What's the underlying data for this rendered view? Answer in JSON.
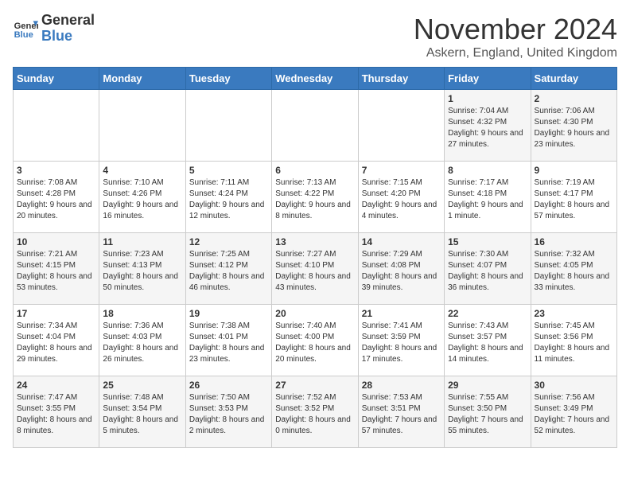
{
  "header": {
    "logo_line1": "General",
    "logo_line2": "Blue",
    "month_title": "November 2024",
    "location": "Askern, England, United Kingdom"
  },
  "weekdays": [
    "Sunday",
    "Monday",
    "Tuesday",
    "Wednesday",
    "Thursday",
    "Friday",
    "Saturday"
  ],
  "weeks": [
    [
      {
        "day": "",
        "info": ""
      },
      {
        "day": "",
        "info": ""
      },
      {
        "day": "",
        "info": ""
      },
      {
        "day": "",
        "info": ""
      },
      {
        "day": "",
        "info": ""
      },
      {
        "day": "1",
        "info": "Sunrise: 7:04 AM\nSunset: 4:32 PM\nDaylight: 9 hours and 27 minutes."
      },
      {
        "day": "2",
        "info": "Sunrise: 7:06 AM\nSunset: 4:30 PM\nDaylight: 9 hours and 23 minutes."
      }
    ],
    [
      {
        "day": "3",
        "info": "Sunrise: 7:08 AM\nSunset: 4:28 PM\nDaylight: 9 hours and 20 minutes."
      },
      {
        "day": "4",
        "info": "Sunrise: 7:10 AM\nSunset: 4:26 PM\nDaylight: 9 hours and 16 minutes."
      },
      {
        "day": "5",
        "info": "Sunrise: 7:11 AM\nSunset: 4:24 PM\nDaylight: 9 hours and 12 minutes."
      },
      {
        "day": "6",
        "info": "Sunrise: 7:13 AM\nSunset: 4:22 PM\nDaylight: 9 hours and 8 minutes."
      },
      {
        "day": "7",
        "info": "Sunrise: 7:15 AM\nSunset: 4:20 PM\nDaylight: 9 hours and 4 minutes."
      },
      {
        "day": "8",
        "info": "Sunrise: 7:17 AM\nSunset: 4:18 PM\nDaylight: 9 hours and 1 minute."
      },
      {
        "day": "9",
        "info": "Sunrise: 7:19 AM\nSunset: 4:17 PM\nDaylight: 8 hours and 57 minutes."
      }
    ],
    [
      {
        "day": "10",
        "info": "Sunrise: 7:21 AM\nSunset: 4:15 PM\nDaylight: 8 hours and 53 minutes."
      },
      {
        "day": "11",
        "info": "Sunrise: 7:23 AM\nSunset: 4:13 PM\nDaylight: 8 hours and 50 minutes."
      },
      {
        "day": "12",
        "info": "Sunrise: 7:25 AM\nSunset: 4:12 PM\nDaylight: 8 hours and 46 minutes."
      },
      {
        "day": "13",
        "info": "Sunrise: 7:27 AM\nSunset: 4:10 PM\nDaylight: 8 hours and 43 minutes."
      },
      {
        "day": "14",
        "info": "Sunrise: 7:29 AM\nSunset: 4:08 PM\nDaylight: 8 hours and 39 minutes."
      },
      {
        "day": "15",
        "info": "Sunrise: 7:30 AM\nSunset: 4:07 PM\nDaylight: 8 hours and 36 minutes."
      },
      {
        "day": "16",
        "info": "Sunrise: 7:32 AM\nSunset: 4:05 PM\nDaylight: 8 hours and 33 minutes."
      }
    ],
    [
      {
        "day": "17",
        "info": "Sunrise: 7:34 AM\nSunset: 4:04 PM\nDaylight: 8 hours and 29 minutes."
      },
      {
        "day": "18",
        "info": "Sunrise: 7:36 AM\nSunset: 4:03 PM\nDaylight: 8 hours and 26 minutes."
      },
      {
        "day": "19",
        "info": "Sunrise: 7:38 AM\nSunset: 4:01 PM\nDaylight: 8 hours and 23 minutes."
      },
      {
        "day": "20",
        "info": "Sunrise: 7:40 AM\nSunset: 4:00 PM\nDaylight: 8 hours and 20 minutes."
      },
      {
        "day": "21",
        "info": "Sunrise: 7:41 AM\nSunset: 3:59 PM\nDaylight: 8 hours and 17 minutes."
      },
      {
        "day": "22",
        "info": "Sunrise: 7:43 AM\nSunset: 3:57 PM\nDaylight: 8 hours and 14 minutes."
      },
      {
        "day": "23",
        "info": "Sunrise: 7:45 AM\nSunset: 3:56 PM\nDaylight: 8 hours and 11 minutes."
      }
    ],
    [
      {
        "day": "24",
        "info": "Sunrise: 7:47 AM\nSunset: 3:55 PM\nDaylight: 8 hours and 8 minutes."
      },
      {
        "day": "25",
        "info": "Sunrise: 7:48 AM\nSunset: 3:54 PM\nDaylight: 8 hours and 5 minutes."
      },
      {
        "day": "26",
        "info": "Sunrise: 7:50 AM\nSunset: 3:53 PM\nDaylight: 8 hours and 2 minutes."
      },
      {
        "day": "27",
        "info": "Sunrise: 7:52 AM\nSunset: 3:52 PM\nDaylight: 8 hours and 0 minutes."
      },
      {
        "day": "28",
        "info": "Sunrise: 7:53 AM\nSunset: 3:51 PM\nDaylight: 7 hours and 57 minutes."
      },
      {
        "day": "29",
        "info": "Sunrise: 7:55 AM\nSunset: 3:50 PM\nDaylight: 7 hours and 55 minutes."
      },
      {
        "day": "30",
        "info": "Sunrise: 7:56 AM\nSunset: 3:49 PM\nDaylight: 7 hours and 52 minutes."
      }
    ]
  ]
}
